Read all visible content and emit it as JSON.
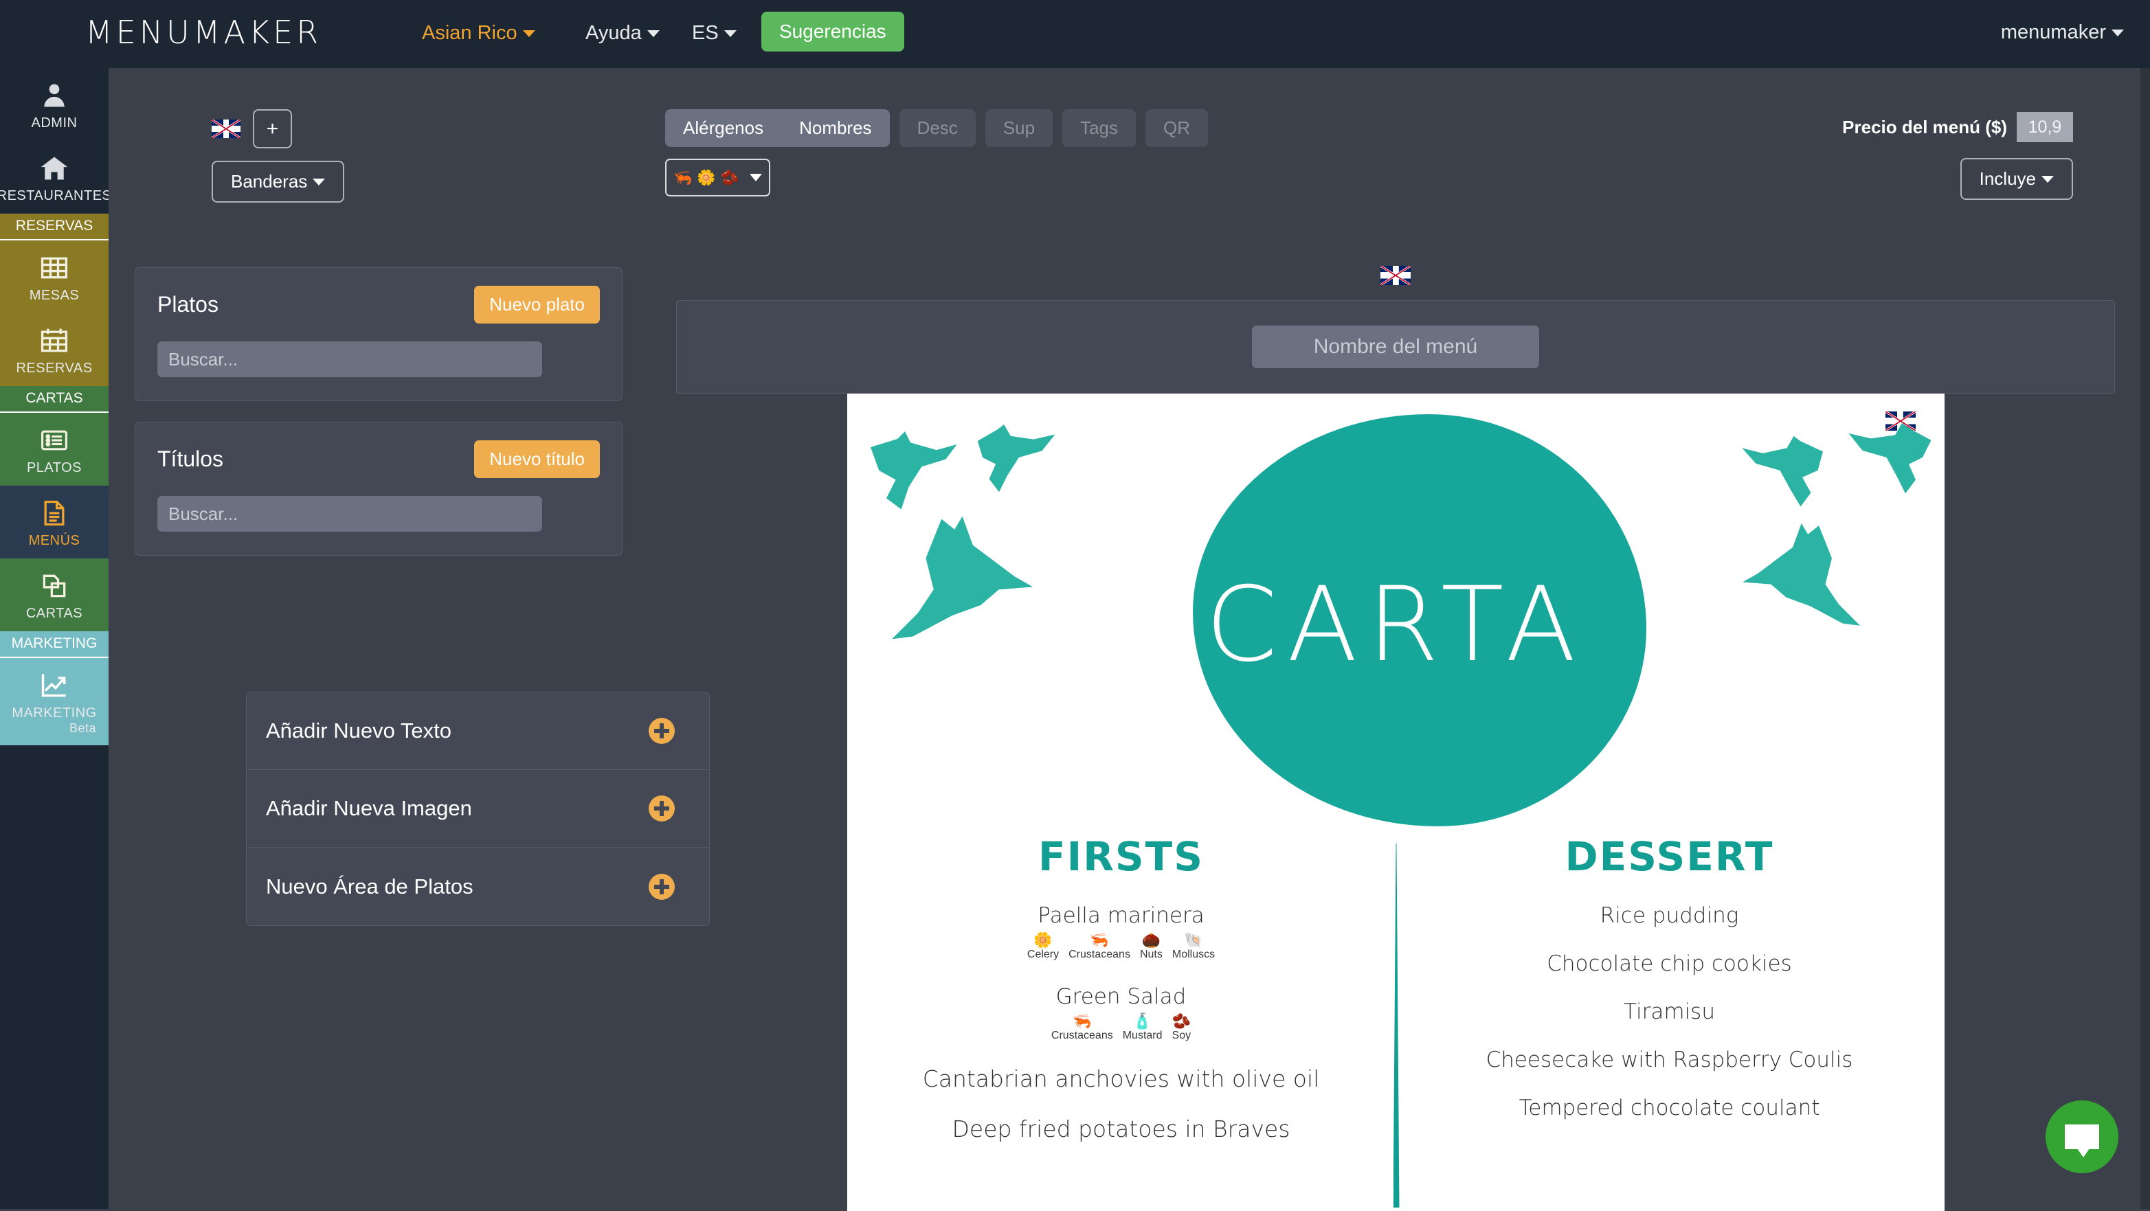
{
  "topnav": {
    "brand": "MENUMAKER",
    "restaurant": "Asian Rico",
    "help": "Ayuda",
    "language": "ES",
    "suggestions": "Sugerencias",
    "user": "menumaker"
  },
  "sidebar": {
    "items": [
      {
        "label": "ADMIN",
        "icon": "user-icon"
      },
      {
        "label": "RESTAURANTES",
        "icon": "home-icon"
      },
      {
        "label": "MESAS",
        "icon": "table-grid-icon"
      },
      {
        "label": "RESERVAS",
        "icon": "calendar-icon"
      },
      {
        "label": "PLATOS",
        "icon": "list-icon"
      },
      {
        "label": "MENÚS",
        "icon": "document-icon"
      },
      {
        "label": "CARTAS",
        "icon": "copy-pages-icon"
      },
      {
        "label": "MARKETING",
        "icon": "trending-up-icon",
        "badge": "Beta"
      }
    ],
    "headings": {
      "reservas": "RESERVAS",
      "cartas": "CARTAS",
      "marketing": "MARKETING"
    },
    "colors": {
      "base": "#1d2733",
      "reservas": "#8a7a24",
      "cartas": "#417a41",
      "marketing": "#76bcc4",
      "active": "#f0a430"
    }
  },
  "toolbar": {
    "flag": "uk-flag",
    "add_flag": "+",
    "banderas": "Banderas",
    "segments": [
      {
        "label": "Alérgenos",
        "active": true
      },
      {
        "label": "Nombres",
        "active": true
      }
    ],
    "buttons": [
      {
        "label": "Desc",
        "disabled": true
      },
      {
        "label": "Sup",
        "disabled": true
      },
      {
        "label": "Tags",
        "disabled": true
      },
      {
        "label": "QR",
        "disabled": true
      }
    ],
    "allergen_select": {
      "icons": [
        "crustaceans",
        "celery",
        "soy"
      ]
    },
    "price_label": "Precio del menú ($)",
    "price_value": "10,9",
    "incluye": "Incluye"
  },
  "left_panel": {
    "cards": [
      {
        "title": "Platos",
        "button": "Nuevo plato",
        "search_placeholder": "Buscar..."
      },
      {
        "title": "Títulos",
        "button": "Nuevo título",
        "search_placeholder": "Buscar..."
      }
    ],
    "actions": [
      {
        "label": "Añadir Nuevo Texto"
      },
      {
        "label": "Añadir Nueva Imagen"
      },
      {
        "label": "Nuevo Área de Platos"
      }
    ]
  },
  "canvas": {
    "flag": "uk-flag",
    "menu_name_placeholder": "Nombre del menú",
    "hero_word": "CARTA",
    "brand_color": "#17a79a",
    "columns": [
      {
        "title": "FIRSTS",
        "dishes": [
          {
            "name": "Paella marinera",
            "allergens": [
              {
                "name": "Celery",
                "glyph": "🌼"
              },
              {
                "name": "Crustaceans",
                "glyph": "🦐"
              },
              {
                "name": "Nuts",
                "glyph": "🌰"
              },
              {
                "name": "Molluscs",
                "glyph": "🐚"
              }
            ]
          },
          {
            "name": "Green Salad",
            "allergens": [
              {
                "name": "Crustaceans",
                "glyph": "🦐"
              },
              {
                "name": "Mustard",
                "glyph": "🧴"
              },
              {
                "name": "Soy",
                "glyph": "🫘"
              }
            ]
          },
          {
            "name": "Cantabrian anchovies with olive oil",
            "allergens": []
          },
          {
            "name": "Deep fried potatoes in Braves",
            "allergens": []
          }
        ]
      },
      {
        "title": "DESSERT",
        "dishes": [
          {
            "name": "Rice pudding",
            "allergens": []
          },
          {
            "name": "Chocolate chip cookies",
            "allergens": []
          },
          {
            "name": "Tiramisu",
            "allergens": []
          },
          {
            "name": "Cheesecake with Raspberry Coulis",
            "allergens": []
          },
          {
            "name": "Tempered chocolate coulant",
            "allergens": []
          }
        ]
      }
    ]
  },
  "chat": {
    "icon": "chat-bubble-icon",
    "color": "#34a532"
  }
}
